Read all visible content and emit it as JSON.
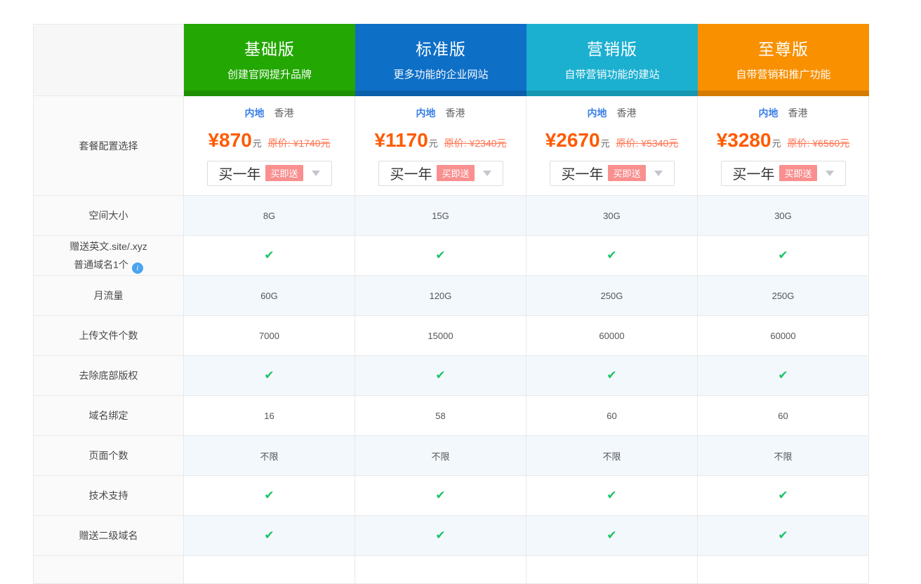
{
  "pricing_table": {
    "plans": [
      {
        "name": "基础版",
        "tagline": "创建官网提升品牌",
        "color": "#23a703",
        "price": "¥870",
        "original": "原价: ¥1740元"
      },
      {
        "name": "标准版",
        "tagline": "更多功能的企业网站",
        "color": "#0e6fc7",
        "price": "¥1170",
        "original": "原价: ¥2340元"
      },
      {
        "name": "营销版",
        "tagline": "自带营销功能的建站",
        "color": "#1bafd0",
        "price": "¥2670",
        "original": "原价: ¥5340元"
      },
      {
        "name": "至尊版",
        "tagline": "自带营销和推广功能",
        "color": "#f89000",
        "price": "¥3280",
        "original": "原价: ¥6560元"
      }
    ],
    "plan_card": {
      "config_label": "套餐配置选择",
      "tabs": [
        "内地",
        "香港"
      ],
      "price_unit": "元",
      "term": "买一年",
      "badge": "买即送",
      "info_icon_glyph": "i"
    },
    "rows": [
      {
        "label": "空间大小",
        "type": "text",
        "values": [
          "8G",
          "15G",
          "30G",
          "30G"
        ]
      },
      {
        "label_line1": "赠送英文.site/.xyz",
        "label_line2": "普通域名1个",
        "type": "check",
        "values": [
          "✔",
          "✔",
          "✔",
          "✔"
        ]
      },
      {
        "label": "月流量",
        "type": "text",
        "values": [
          "60G",
          "120G",
          "250G",
          "250G"
        ]
      },
      {
        "label": "上传文件个数",
        "type": "text",
        "values": [
          "7000",
          "15000",
          "60000",
          "60000"
        ]
      },
      {
        "label": "去除底部版权",
        "type": "check",
        "values": [
          "✔",
          "✔",
          "✔",
          "✔"
        ]
      },
      {
        "label": "域名绑定",
        "type": "text",
        "values": [
          "16",
          "58",
          "60",
          "60"
        ]
      },
      {
        "label": "页面个数",
        "type": "text",
        "values": [
          "不限",
          "不限",
          "不限",
          "不限"
        ]
      },
      {
        "label": "技术支持",
        "type": "check",
        "values": [
          "✔",
          "✔",
          "✔",
          "✔"
        ]
      },
      {
        "label": "赠送二级域名",
        "type": "check",
        "values": [
          "✔",
          "✔",
          "✔",
          "✔"
        ]
      }
    ],
    "colors": {
      "price": "#ff5a00",
      "original_price": "#ff7250",
      "tab_active": "#3a7fe8",
      "tab_inactive": "#666666",
      "badge_bg": "#f98f8f",
      "check": "#1dc268",
      "alt_row_bg": "#f3f8fd",
      "label_col_bg": "#fafafa",
      "border": "#e9e9e9",
      "info_icon": "#4aa3ef"
    }
  }
}
